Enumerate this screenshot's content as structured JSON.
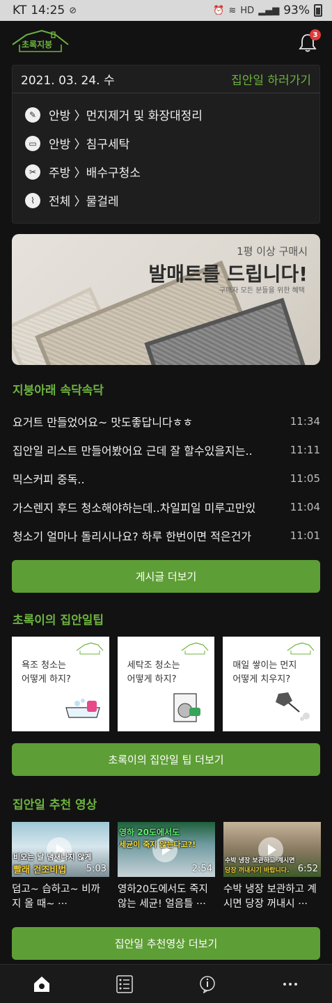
{
  "status": {
    "carrier": "KT",
    "time": "14:25",
    "network": "HD",
    "battery": "93%"
  },
  "header": {
    "logo_text": "초록지붕",
    "notifications_count": "3"
  },
  "tasks": {
    "date": "2021. 03. 24. 수",
    "go_link": "집안일 하러가기",
    "items": [
      {
        "label": "안방 〉먼지제거 및 화장대정리",
        "icon": "duster-icon"
      },
      {
        "label": "안방 〉침구세탁",
        "icon": "laundry-icon"
      },
      {
        "label": "주방 〉배수구청소",
        "icon": "drain-brush-icon"
      },
      {
        "label": "전체 〉물걸레",
        "icon": "mop-icon"
      }
    ]
  },
  "banner": {
    "sub": "1평 이상 구매시",
    "title": "발매트를 드립니다!",
    "small": "구매자 모든 분들을 위한 혜택"
  },
  "community": {
    "title": "지붕아래 속닥속닥",
    "posts": [
      {
        "title": "요거트 만들었어요~  맛도좋답니다ㅎㅎ",
        "time": "11:34"
      },
      {
        "title": "집안일 리스트 만들어봤어요 근데 잘 할수있을지는..",
        "time": "11:11"
      },
      {
        "title": "믹스커피 중독..",
        "time": "11:05"
      },
      {
        "title": "가스렌지 후드 청소해야하는데..차일피일 미루고만있",
        "time": "11:04"
      },
      {
        "title": "청소기 얼마나 돌리시나요?  하루 한번이면 적은건가",
        "time": "11:01"
      }
    ],
    "more_label": "게시글 더보기"
  },
  "tips": {
    "title": "초록이의 집안일팁",
    "cards": [
      {
        "line1": "욕조 청소는",
        "line2": "어떻게 하지?"
      },
      {
        "line1": "세탁조 청소는",
        "line2": "어떻게 하지?"
      },
      {
        "line1": "매일  쌓이는 먼지",
        "line2": "어떻게 치우지?"
      }
    ],
    "more_label": "초록이의 집안일 팁 더보기"
  },
  "videos": {
    "title": "집안일 추천 영상",
    "items": [
      {
        "caption1": "비오는 날 냄새나지 않게",
        "caption2": "빨래 건조비법",
        "duration": "5:03",
        "title": "덥고~ 습하고~ 비까지 올 때~ ···"
      },
      {
        "caption1": "영하 20도에서도",
        "caption2": "세균이 죽지 않는다고?!",
        "duration": "2:54",
        "title": "영하20도에서도 죽지않는 세균! 얼음틀 ···"
      },
      {
        "caption1": "수박 냉장 보관하고 계시면",
        "caption2": "당장 꺼내시기 바랍니다.",
        "duration": "6:52",
        "title": "수박 냉장 보관하고 계시면 당장 꺼내시 ···"
      }
    ],
    "more_label": "집안일 추천영상 더보기"
  },
  "colors": {
    "accent": "#6db33f",
    "button": "#5e9e36",
    "background": "#121212",
    "badge": "#e23a3a"
  }
}
